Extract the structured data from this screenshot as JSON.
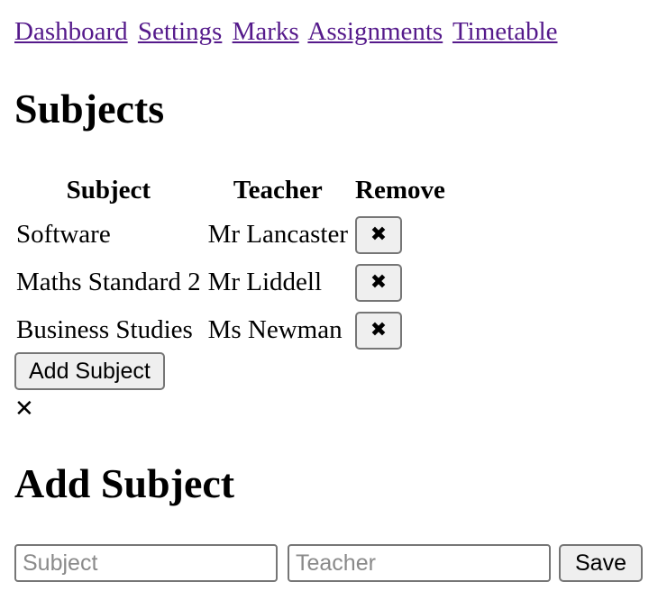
{
  "nav": {
    "links": [
      "Dashboard",
      "Settings",
      "Marks",
      "Assignments",
      "Timetable"
    ]
  },
  "subjects_section": {
    "title": "Subjects",
    "columns": [
      "Subject",
      "Teacher",
      "Remove"
    ],
    "rows": [
      {
        "subject": "Software",
        "teacher": "Mr Lancaster",
        "remove_icon": "✖"
      },
      {
        "subject": "Maths Standard 2",
        "teacher": "Mr Liddell",
        "remove_icon": "✖"
      },
      {
        "subject": "Business Studies",
        "teacher": "Ms Newman",
        "remove_icon": "✖"
      }
    ],
    "add_button_label": "Add Subject",
    "close_icon": "✕"
  },
  "add_form": {
    "title": "Add Subject",
    "subject_placeholder": "Subject",
    "subject_value": "",
    "teacher_placeholder": "Teacher",
    "teacher_value": "",
    "save_label": "Save"
  },
  "colors": {
    "link": "#551a8b",
    "button_bg": "#efefef",
    "button_border": "#767676"
  }
}
